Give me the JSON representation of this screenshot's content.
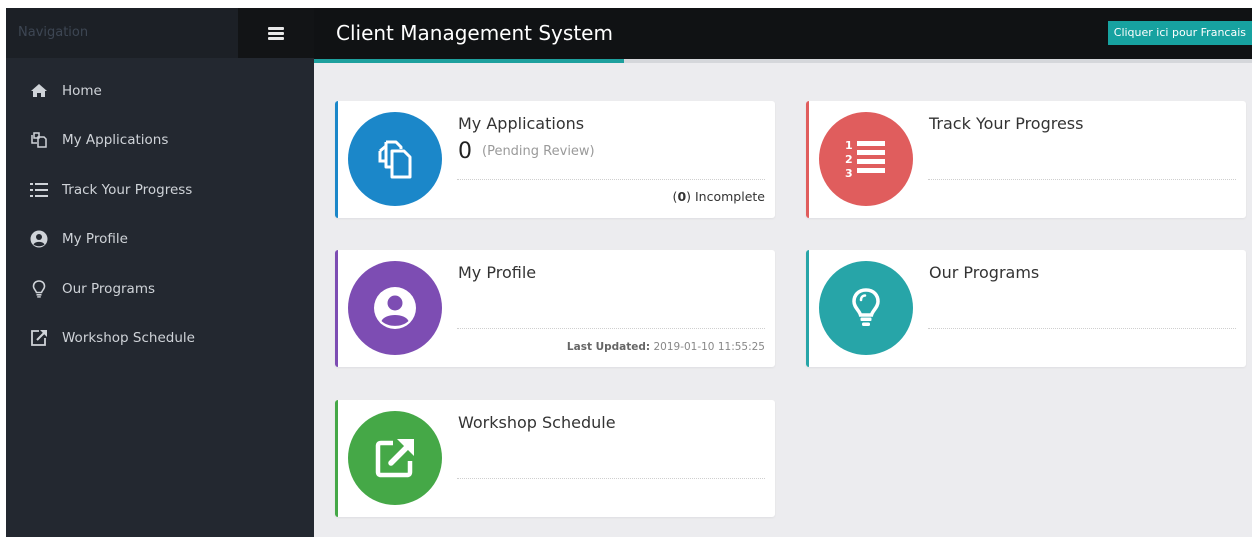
{
  "sidebar": {
    "nav_title": "Navigation",
    "items": [
      {
        "label": "Home",
        "icon": "home-icon"
      },
      {
        "label": "My Applications",
        "icon": "copy-icon"
      },
      {
        "label": "Track Your Progress",
        "icon": "list-ol-icon"
      },
      {
        "label": "My Profile",
        "icon": "user-circle-icon"
      },
      {
        "label": "Our Programs",
        "icon": "lightbulb-icon"
      },
      {
        "label": "Workshop Schedule",
        "icon": "external-link-icon"
      }
    ]
  },
  "header": {
    "title": "Client Management System",
    "language_button": "Cliquer ici pour Francais"
  },
  "cards": {
    "applications": {
      "title": "My Applications",
      "count": "0",
      "count_label": "(Pending Review)",
      "incomplete_count": "0",
      "incomplete_label": "Incomplete",
      "color": "#1b87c9",
      "icon": "copy-icon"
    },
    "progress": {
      "title": "Track Your Progress",
      "color": "#e05d5d",
      "icon": "list-ol-icon"
    },
    "profile": {
      "title": "My Profile",
      "last_updated_label": "Last Updated:",
      "last_updated_value": "2019-01-10 11:55:25",
      "color": "#7d4db3",
      "icon": "user-circle-icon"
    },
    "programs": {
      "title": "Our Programs",
      "color": "#27a5a8",
      "icon": "lightbulb-icon"
    },
    "workshop": {
      "title": "Workshop Schedule",
      "color": "#45a847",
      "icon": "external-link-icon"
    }
  },
  "colors": {
    "sidebar_bg": "#232830",
    "topbar_bg": "#101214",
    "accent_teal": "#17a2a0",
    "main_bg": "#ececef"
  }
}
